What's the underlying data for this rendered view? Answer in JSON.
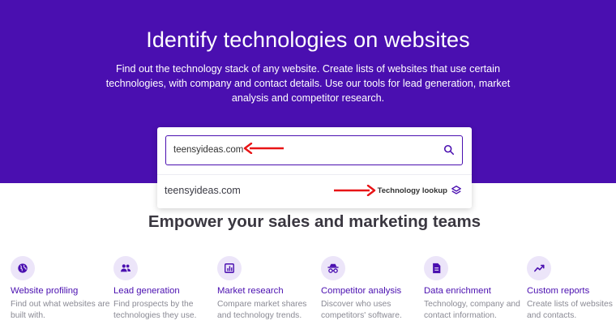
{
  "hero": {
    "title": "Identify technologies on websites",
    "subtitle": "Find out the technology stack of any website. Create lists of websites that use certain technologies, with company and contact details. Use our tools for lead generation, market analysis and competitor research."
  },
  "search": {
    "value": "teensyideas.com",
    "icon": "search-icon"
  },
  "suggestion": {
    "domain": "teensyideas.com",
    "action_label": "Technology lookup",
    "icon": "layers-icon"
  },
  "section": {
    "title": "Empower your sales and marketing teams"
  },
  "features": [
    {
      "icon": "globe-icon",
      "title": "Website profiling",
      "desc": "Find out what websites are built with."
    },
    {
      "icon": "users-icon",
      "title": "Lead generation",
      "desc": "Find prospects by the technologies they use."
    },
    {
      "icon": "chart-icon",
      "title": "Market research",
      "desc": "Compare market shares and technology trends."
    },
    {
      "icon": "spy-icon",
      "title": "Competitor analysis",
      "desc": "Discover who uses competitors' software."
    },
    {
      "icon": "document-icon",
      "title": "Data enrichment",
      "desc": "Technology, company and contact information."
    },
    {
      "icon": "trend-icon",
      "title": "Custom reports",
      "desc": "Create lists of websites and contacts."
    }
  ],
  "colors": {
    "brand": "#4a0fb0",
    "annotation_arrow": "#e81416",
    "icon_bg": "#ece5f9"
  }
}
